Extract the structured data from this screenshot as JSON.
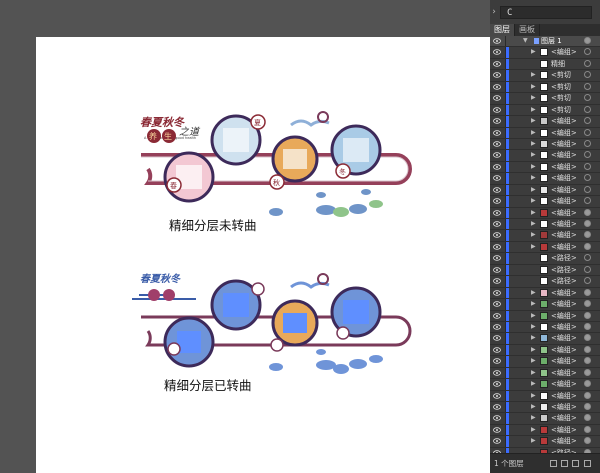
{
  "toolbar": {
    "field_value": "C",
    "chevron": "›"
  },
  "artboard": {
    "top_caption": "精细分层未转曲",
    "bottom_caption": "精细分层已转曲",
    "title_top": "春夏秋冬",
    "subtitle_top": "养生之道",
    "title_bottom": "春夏秋冬"
  },
  "layers_panel": {
    "tabs": [
      "图层",
      "画板"
    ],
    "top_layer": "图层 1",
    "items": [
      {
        "label": "<编组>",
        "has_triangle": true,
        "target": "empty"
      },
      {
        "label": "精细",
        "has_triangle": false,
        "target": "empty"
      },
      {
        "label": "<剪切",
        "has_triangle": true,
        "target": "empty"
      },
      {
        "label": "<剪切",
        "has_triangle": true,
        "target": "empty"
      },
      {
        "label": "<剪切",
        "has_triangle": true,
        "target": "empty"
      },
      {
        "label": "<剪切",
        "has_triangle": true,
        "target": "empty"
      },
      {
        "label": "<编组>",
        "has_triangle": true,
        "target": "empty"
      },
      {
        "label": "<编组>",
        "has_triangle": true,
        "target": "empty"
      },
      {
        "label": "<编组>",
        "has_triangle": true,
        "target": "empty"
      },
      {
        "label": "<编组>",
        "has_triangle": true,
        "target": "empty"
      },
      {
        "label": "<编组>",
        "has_triangle": true,
        "target": "empty"
      },
      {
        "label": "<编组>",
        "has_triangle": true,
        "target": "empty"
      },
      {
        "label": "<编组>",
        "has_triangle": true,
        "target": "empty"
      },
      {
        "label": "<编组>",
        "has_triangle": true,
        "target": "empty"
      },
      {
        "label": "<编组>",
        "has_triangle": true,
        "target": "filled"
      },
      {
        "label": "<编组>",
        "has_triangle": true,
        "target": "filled"
      },
      {
        "label": "<编组>",
        "has_triangle": true,
        "target": "filled"
      },
      {
        "label": "<编组>",
        "has_triangle": true,
        "target": "filled"
      },
      {
        "label": "<路径>",
        "has_triangle": false,
        "target": "empty"
      },
      {
        "label": "<路径>",
        "has_triangle": false,
        "target": "empty"
      },
      {
        "label": "<路径>",
        "has_triangle": false,
        "target": "empty"
      },
      {
        "label": "<编组>",
        "has_triangle": true,
        "target": "filled"
      },
      {
        "label": "<编组>",
        "has_triangle": true,
        "target": "filled"
      },
      {
        "label": "<编组>",
        "has_triangle": true,
        "target": "filled"
      },
      {
        "label": "<编组>",
        "has_triangle": true,
        "target": "filled"
      },
      {
        "label": "<编组>",
        "has_triangle": true,
        "target": "filled"
      },
      {
        "label": "<编组>",
        "has_triangle": true,
        "target": "filled"
      },
      {
        "label": "<编组>",
        "has_triangle": true,
        "target": "filled"
      },
      {
        "label": "<编组>",
        "has_triangle": true,
        "target": "filled"
      },
      {
        "label": "<编组>",
        "has_triangle": true,
        "target": "filled"
      },
      {
        "label": "<编组>",
        "has_triangle": true,
        "target": "filled"
      },
      {
        "label": "<编组>",
        "has_triangle": true,
        "target": "filled"
      },
      {
        "label": "<编组>",
        "has_triangle": true,
        "target": "filled"
      },
      {
        "label": "<编组>",
        "has_triangle": true,
        "target": "filled"
      },
      {
        "label": "<编组>",
        "has_triangle": true,
        "target": "filled"
      },
      {
        "label": "<路径>",
        "has_triangle": false,
        "target": "filled"
      }
    ],
    "footer": "1 个图层"
  },
  "colors": {
    "canvas": "#535353",
    "panel": "#3c3c3c",
    "selection": "#3b6cff",
    "ring": "#7a3a5a"
  }
}
